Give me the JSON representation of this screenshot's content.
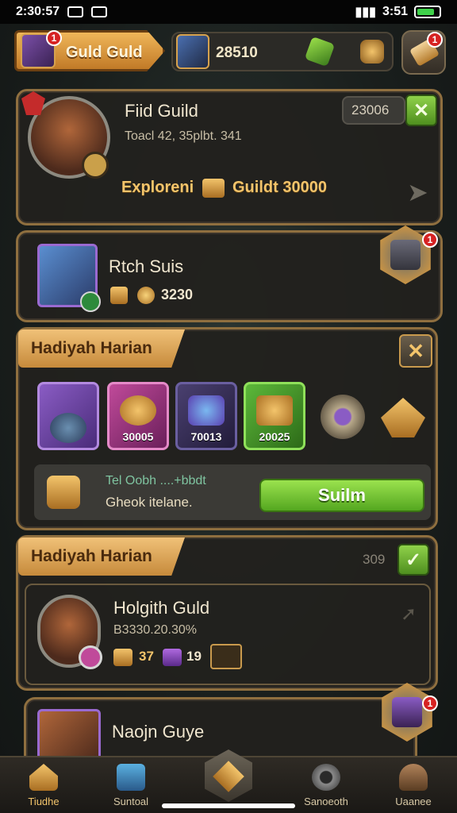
{
  "status_bar": {
    "time": "2:30:57",
    "network": "3:51",
    "battery_level": 0.8
  },
  "top_bar": {
    "guild_tab_label": "Guld Guld",
    "guild_badge": "1",
    "resource_amount": "28510",
    "corner_badge": "1"
  },
  "guild_card": {
    "name": "Fiid Guild",
    "subtitle": "Toacl 42, 35plbt. 341",
    "explore_label": "Exploreni",
    "reward_label": "Guildt 30000",
    "chip_value": "23006"
  },
  "member_card": {
    "name": "Rtch Suis",
    "gold_amount": "3230",
    "badge": "1"
  },
  "daily_reward": {
    "header": "Hadiyah Harian",
    "items": [
      {
        "name": "hero-reward",
        "value": "",
        "color": "#7a4fb0"
      },
      {
        "name": "gold-horn",
        "value": "30005",
        "color": "#a03f8e"
      },
      {
        "name": "crystal-shield",
        "value": "70013",
        "color": "#3c3560"
      },
      {
        "name": "gold-chest",
        "value": "20025",
        "color": "#3f8f24"
      },
      {
        "name": "amulet",
        "value": "",
        "color": "transparent"
      },
      {
        "name": "golden-helm",
        "value": "",
        "color": "transparent"
      }
    ],
    "info_line1": "Tel Oobh ....+bbdt",
    "info_line2": "Gheok itelane.",
    "claim_label": "Suilm"
  },
  "second_daily": {
    "header": "Hadiyah Harian",
    "chip_value": "309",
    "name": "Holgith Guld",
    "subtitle": "B3330.20.30%",
    "gold_count": "37",
    "gem_count": "19"
  },
  "bottom_card": {
    "name": "Naojn Guye",
    "badge": "1"
  },
  "nav": [
    {
      "label": "Tiudhe"
    },
    {
      "label": "Suntoal"
    },
    {
      "label": ""
    },
    {
      "label": "Sanoeoth"
    },
    {
      "label": "Uaanee"
    }
  ]
}
